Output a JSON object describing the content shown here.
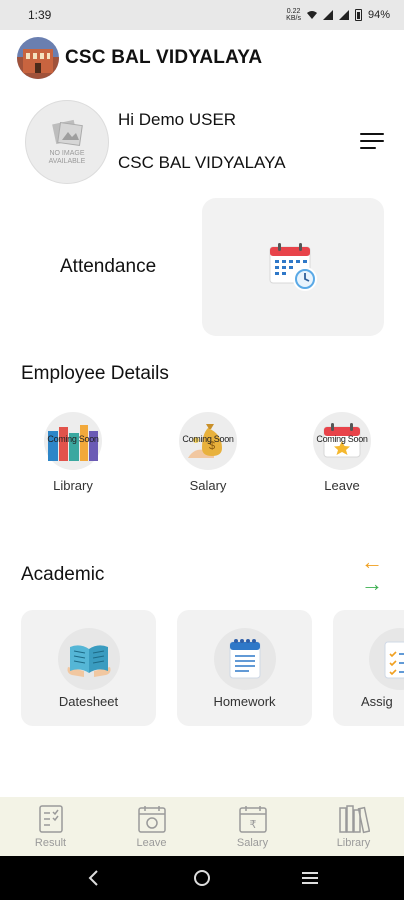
{
  "status": {
    "time": "1:39",
    "speed_top": "0.22",
    "speed_bottom": "KB/s",
    "battery": "94%"
  },
  "app": {
    "title": "CSC BAL VIDYALAYA"
  },
  "profile": {
    "no_image_line1": "NO IMAGE",
    "no_image_line2": "AVAILABLE",
    "greeting": "Hi Demo USER",
    "school": "CSC BAL VIDYALAYA"
  },
  "attendance": {
    "label": "Attendance"
  },
  "employee": {
    "title": "Employee Details",
    "items": [
      {
        "label": "Library",
        "badge": "Coming Soon"
      },
      {
        "label": "Salary",
        "badge": "Coming Soon"
      },
      {
        "label": "Leave",
        "badge": "Coming Soon"
      }
    ]
  },
  "academic": {
    "title": "Academic",
    "arrow_left": "←",
    "arrow_right": "→",
    "items": [
      {
        "label": "Datesheet"
      },
      {
        "label": "Homework"
      },
      {
        "label": "Assig"
      }
    ]
  },
  "bottom_nav": [
    {
      "label": "Result"
    },
    {
      "label": "Leave"
    },
    {
      "label": "Salary"
    },
    {
      "label": "Library"
    }
  ],
  "colors": {
    "arrow_left": "#f0a020",
    "arrow_right": "#3cb050",
    "nav_bg": "#f3f3e6"
  }
}
